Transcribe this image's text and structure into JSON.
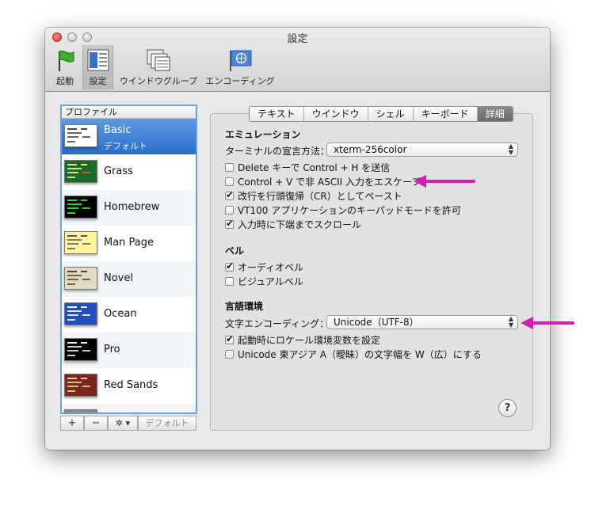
{
  "window": {
    "title": "設定"
  },
  "toolbar": [
    {
      "label": "起動",
      "icon": "flag-icon"
    },
    {
      "label": "設定",
      "icon": "settings-window-icon"
    },
    {
      "label": "ウインドウグループ",
      "icon": "window-group-icon"
    },
    {
      "label": "エンコーディング",
      "icon": "globe-flag-icon"
    }
  ],
  "profiles": {
    "header": "プロファイル",
    "items": [
      {
        "name": "Basic",
        "subtitle": "デフォルト"
      },
      {
        "name": "Grass"
      },
      {
        "name": "Homebrew"
      },
      {
        "name": "Man Page"
      },
      {
        "name": "Novel"
      },
      {
        "name": "Ocean"
      },
      {
        "name": "Pro"
      },
      {
        "name": "Red Sands"
      }
    ],
    "buttons": {
      "add": "+",
      "remove": "−",
      "gear": "✲ ▾",
      "default": "デフォルト"
    }
  },
  "tabs": [
    "テキスト",
    "ウインドウ",
    "シェル",
    "キーボード",
    "詳細"
  ],
  "emulation": {
    "title": "エミュレーション",
    "declare_label": "ターミナルの宣言方法：",
    "declare_value": "xterm-256color",
    "options": [
      {
        "label": "Delete キーで Control + H を送信",
        "checked": false
      },
      {
        "label": "Control + V で非 ASCII 入力をエスケープ",
        "checked": false
      },
      {
        "label": "改行を行頭復帰（CR）としてペースト",
        "checked": true
      },
      {
        "label": "VT100 アプリケーションのキーパッドモードを許可",
        "checked": false
      },
      {
        "label": "入力時に下端までスクロール",
        "checked": true
      }
    ]
  },
  "bell": {
    "title": "ベル",
    "options": [
      {
        "label": "オーディオベル",
        "checked": true
      },
      {
        "label": "ビジュアルベル",
        "checked": false
      }
    ]
  },
  "language": {
    "title": "言語環境",
    "encoding_label": "文字エンコーディング：",
    "encoding_value": "Unicode（UTF-8）",
    "options": [
      {
        "label": "起動時にロケール環境変数を設定",
        "checked": true
      },
      {
        "label": "Unicode 東アジア A（曖昧）の文字幅を W（広）にする",
        "checked": false
      }
    ]
  },
  "help": "?",
  "colors": {
    "accent_arrow": "#d01fb4",
    "selection": "#3a7bd5",
    "thumb_basic": "#ffffff",
    "thumb_grass": "#1a6b2a",
    "thumb_homebrew": "#000000",
    "thumb_manpage": "#fef49c",
    "thumb_novel": "#dfdbc3",
    "thumb_ocean": "#224fbc",
    "thumb_pro": "#000000",
    "thumb_redsands": "#7a251e"
  }
}
